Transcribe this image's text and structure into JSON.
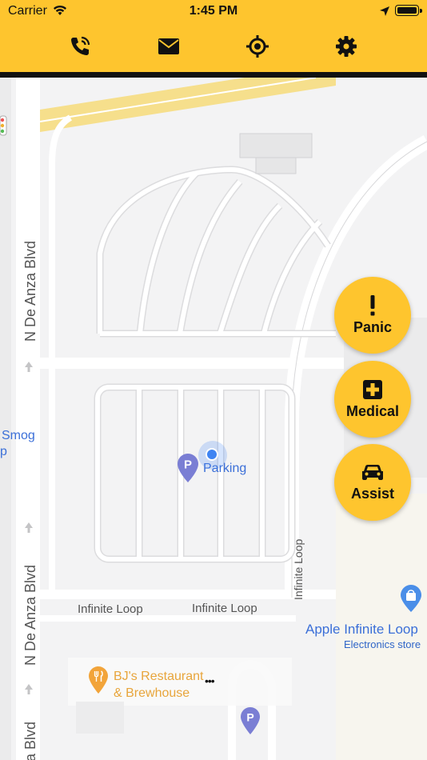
{
  "status": {
    "carrier": "Carrier",
    "time": "1:45 PM"
  },
  "toolbar": {
    "call_icon": "phone-call-icon",
    "mail_icon": "mail-icon",
    "locate_icon": "crosshair-icon",
    "settings_icon": "gear-icon",
    "background": "#FEC52E"
  },
  "map": {
    "roads": {
      "de_anza_1": "N De Anza Blvd",
      "de_anza_2": "N De Anza Blvd",
      "de_anza_3": "a Blvd",
      "infinite_loop_1": "Infinite Loop",
      "infinite_loop_2": "Infinite Loop",
      "infinite_loop_3": "Infinite Loop"
    },
    "places": {
      "parking": "Parking",
      "smog": "Smog",
      "smog_line2": "p",
      "apple_name": "Apple Infinite Loop",
      "apple_category": "Electronics store",
      "bjs_line1": "BJ's Restaurant",
      "bjs_line2": "& Brewhouse",
      "more": "•••"
    }
  },
  "actions": [
    {
      "label": "Panic",
      "icon": "exclamation-icon"
    },
    {
      "label": "Medical",
      "icon": "medical-cross-icon"
    },
    {
      "label": "Assist",
      "icon": "car-icon"
    }
  ]
}
